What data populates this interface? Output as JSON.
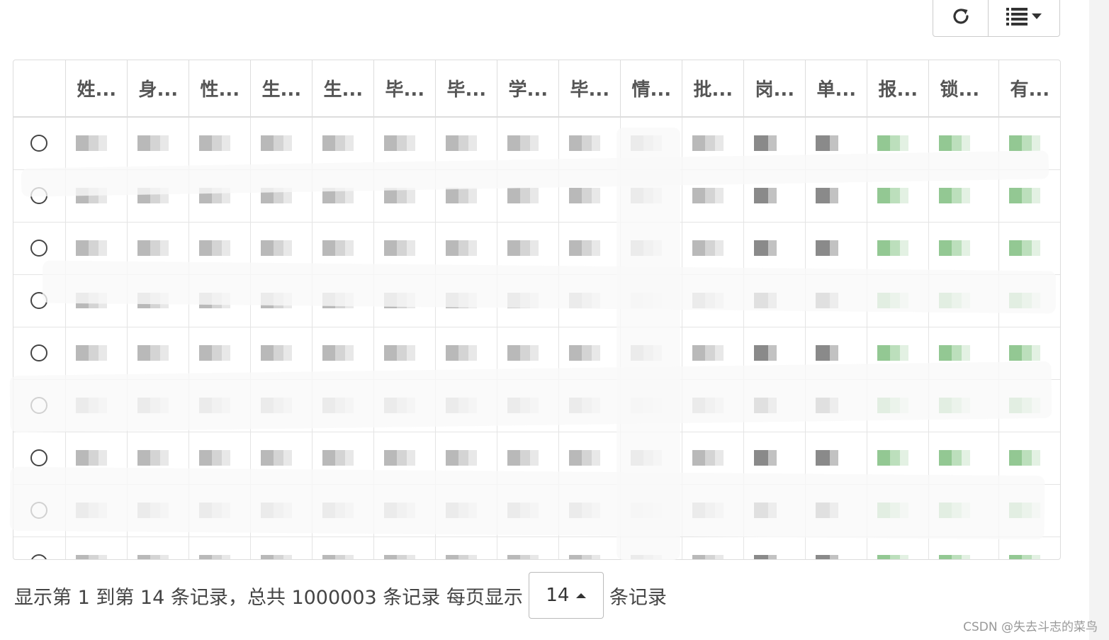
{
  "toolbar": {
    "refresh_icon": "refresh-icon",
    "columns_icon": "list-columns-icon",
    "dropdown_icon": "caret-down-icon"
  },
  "table": {
    "columns": [
      "姓...",
      "身...",
      "性...",
      "生...",
      "生...",
      "毕...",
      "毕...",
      "学...",
      "毕...",
      "情...",
      "批...",
      "岗...",
      "单...",
      "报...",
      "锁...",
      "有..."
    ],
    "row_count_visible": 9,
    "cell_content": "redacted"
  },
  "pagination": {
    "summary": "显示第 1 到第 14 条记录，总共 1000003 条记录 每页显示",
    "page_size": "14",
    "suffix": "条记录"
  },
  "watermark": "CSDN @失去斗志的菜鸟",
  "colors": {
    "border": "#dddddd",
    "text": "#444444",
    "green_cell": "#93c893"
  }
}
